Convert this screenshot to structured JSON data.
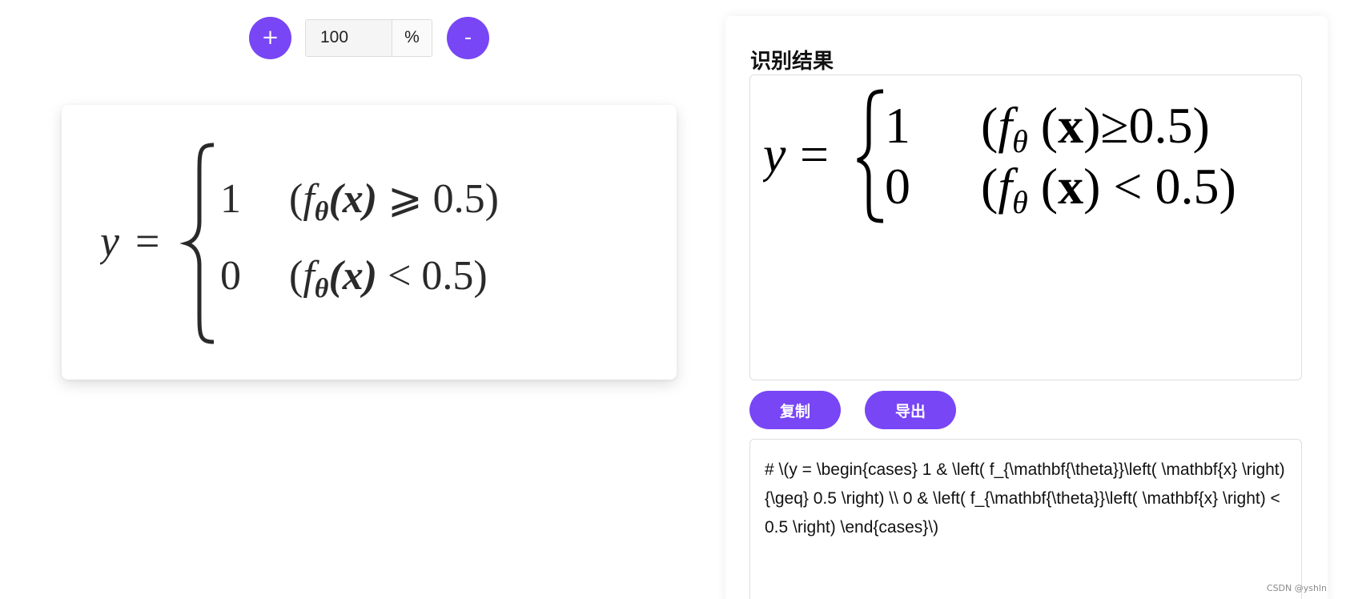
{
  "toolbar": {
    "zoom_in_label": "+",
    "zoom_value": "100",
    "zoom_unit": "%",
    "zoom_out_label": "-"
  },
  "preview": {
    "lhs": "y",
    "eq": "=",
    "case1_value": "1",
    "case1_cond_f": "f",
    "case1_cond_sub": "θ",
    "case1_cond_arg": "(x)",
    "case1_cond_op": "⩾",
    "case1_cond_num": "0.5",
    "case2_value": "0",
    "case2_cond_f": "f",
    "case2_cond_sub": "θ",
    "case2_cond_arg": "(x)",
    "case2_cond_op": "<",
    "case2_cond_num": "0.5"
  },
  "result": {
    "title": "识别结果",
    "lhs": "y",
    "eq": "=",
    "case1_value": "1",
    "case1_cond_op": "≥",
    "case1_cond_num": "0.5",
    "case2_value": "0",
    "case2_cond_op": "<",
    "case2_cond_num": "0.5",
    "f": "f",
    "theta": "θ",
    "x": "x"
  },
  "actions": {
    "copy_label": "复制",
    "export_label": "导出"
  },
  "latex_output": "# \\(y = \\begin{cases} 1 & \\left( f_{\\mathbf{\\theta}}\\left( \\mathbf{x} \\right) {\\geq} 0.5 \\right) \\\\ 0 & \\left( f_{\\mathbf{\\theta}}\\left( \\mathbf{x} \\right) < 0.5 \\right) \\end{cases}\\)",
  "watermark": "CSDN @yshln",
  "colors": {
    "accent": "#7846f5"
  }
}
